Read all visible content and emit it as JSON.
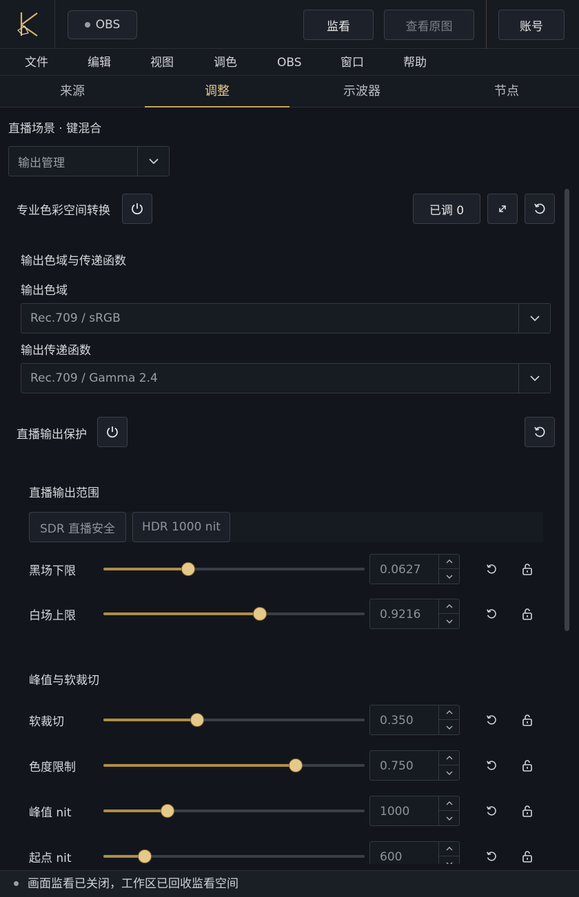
{
  "topbar": {
    "obs_label": "OBS",
    "monitor_label": "监看",
    "view_original_label": "查看原图",
    "account_label": "账号"
  },
  "menu": [
    "文件",
    "编辑",
    "视图",
    "调色",
    "OBS",
    "窗口",
    "帮助"
  ],
  "tabs": [
    "来源",
    "调整",
    "示波器",
    "节点"
  ],
  "active_tab": "调整",
  "breadcrumb": "直播场景 · 键混合",
  "output_select": "输出管理",
  "section_colorspace": {
    "title": "专业色彩空间转换",
    "adjusted_label": "已调 0",
    "group_title": "输出色域与传递函数",
    "gamut_label": "输出色域",
    "gamut_value": "Rec.709 / sRGB",
    "transfer_label": "输出传递函数",
    "transfer_value": "Rec.709 / Gamma 2.4"
  },
  "section_protect": {
    "title": "直播输出保护",
    "range_title": "直播输出范围",
    "preset_sdr": "SDR 直播安全",
    "preset_hdr": "HDR 1000 nit",
    "peak_title": "峰值与软裁切"
  },
  "sliders": [
    {
      "label": "黑场下限",
      "value": "0.0627",
      "fraction": 0.325
    },
    {
      "label": "白场上限",
      "value": "0.9216",
      "fraction": 0.6
    },
    {
      "label": "软裁切",
      "value": "0.350",
      "fraction": 0.36
    },
    {
      "label": "色度限制",
      "value": "0.750",
      "fraction": 0.735
    },
    {
      "label": "峰值 nit",
      "value": "1000",
      "fraction": 0.245
    },
    {
      "label": "起点 nit",
      "value": "600",
      "fraction": 0.158
    }
  ],
  "status_text": "画面监看已关闭，工作区已回收监看空间",
  "colors": {
    "accent": "#c9a458",
    "thumb": "#e5c98a",
    "bg": "#12161c"
  }
}
